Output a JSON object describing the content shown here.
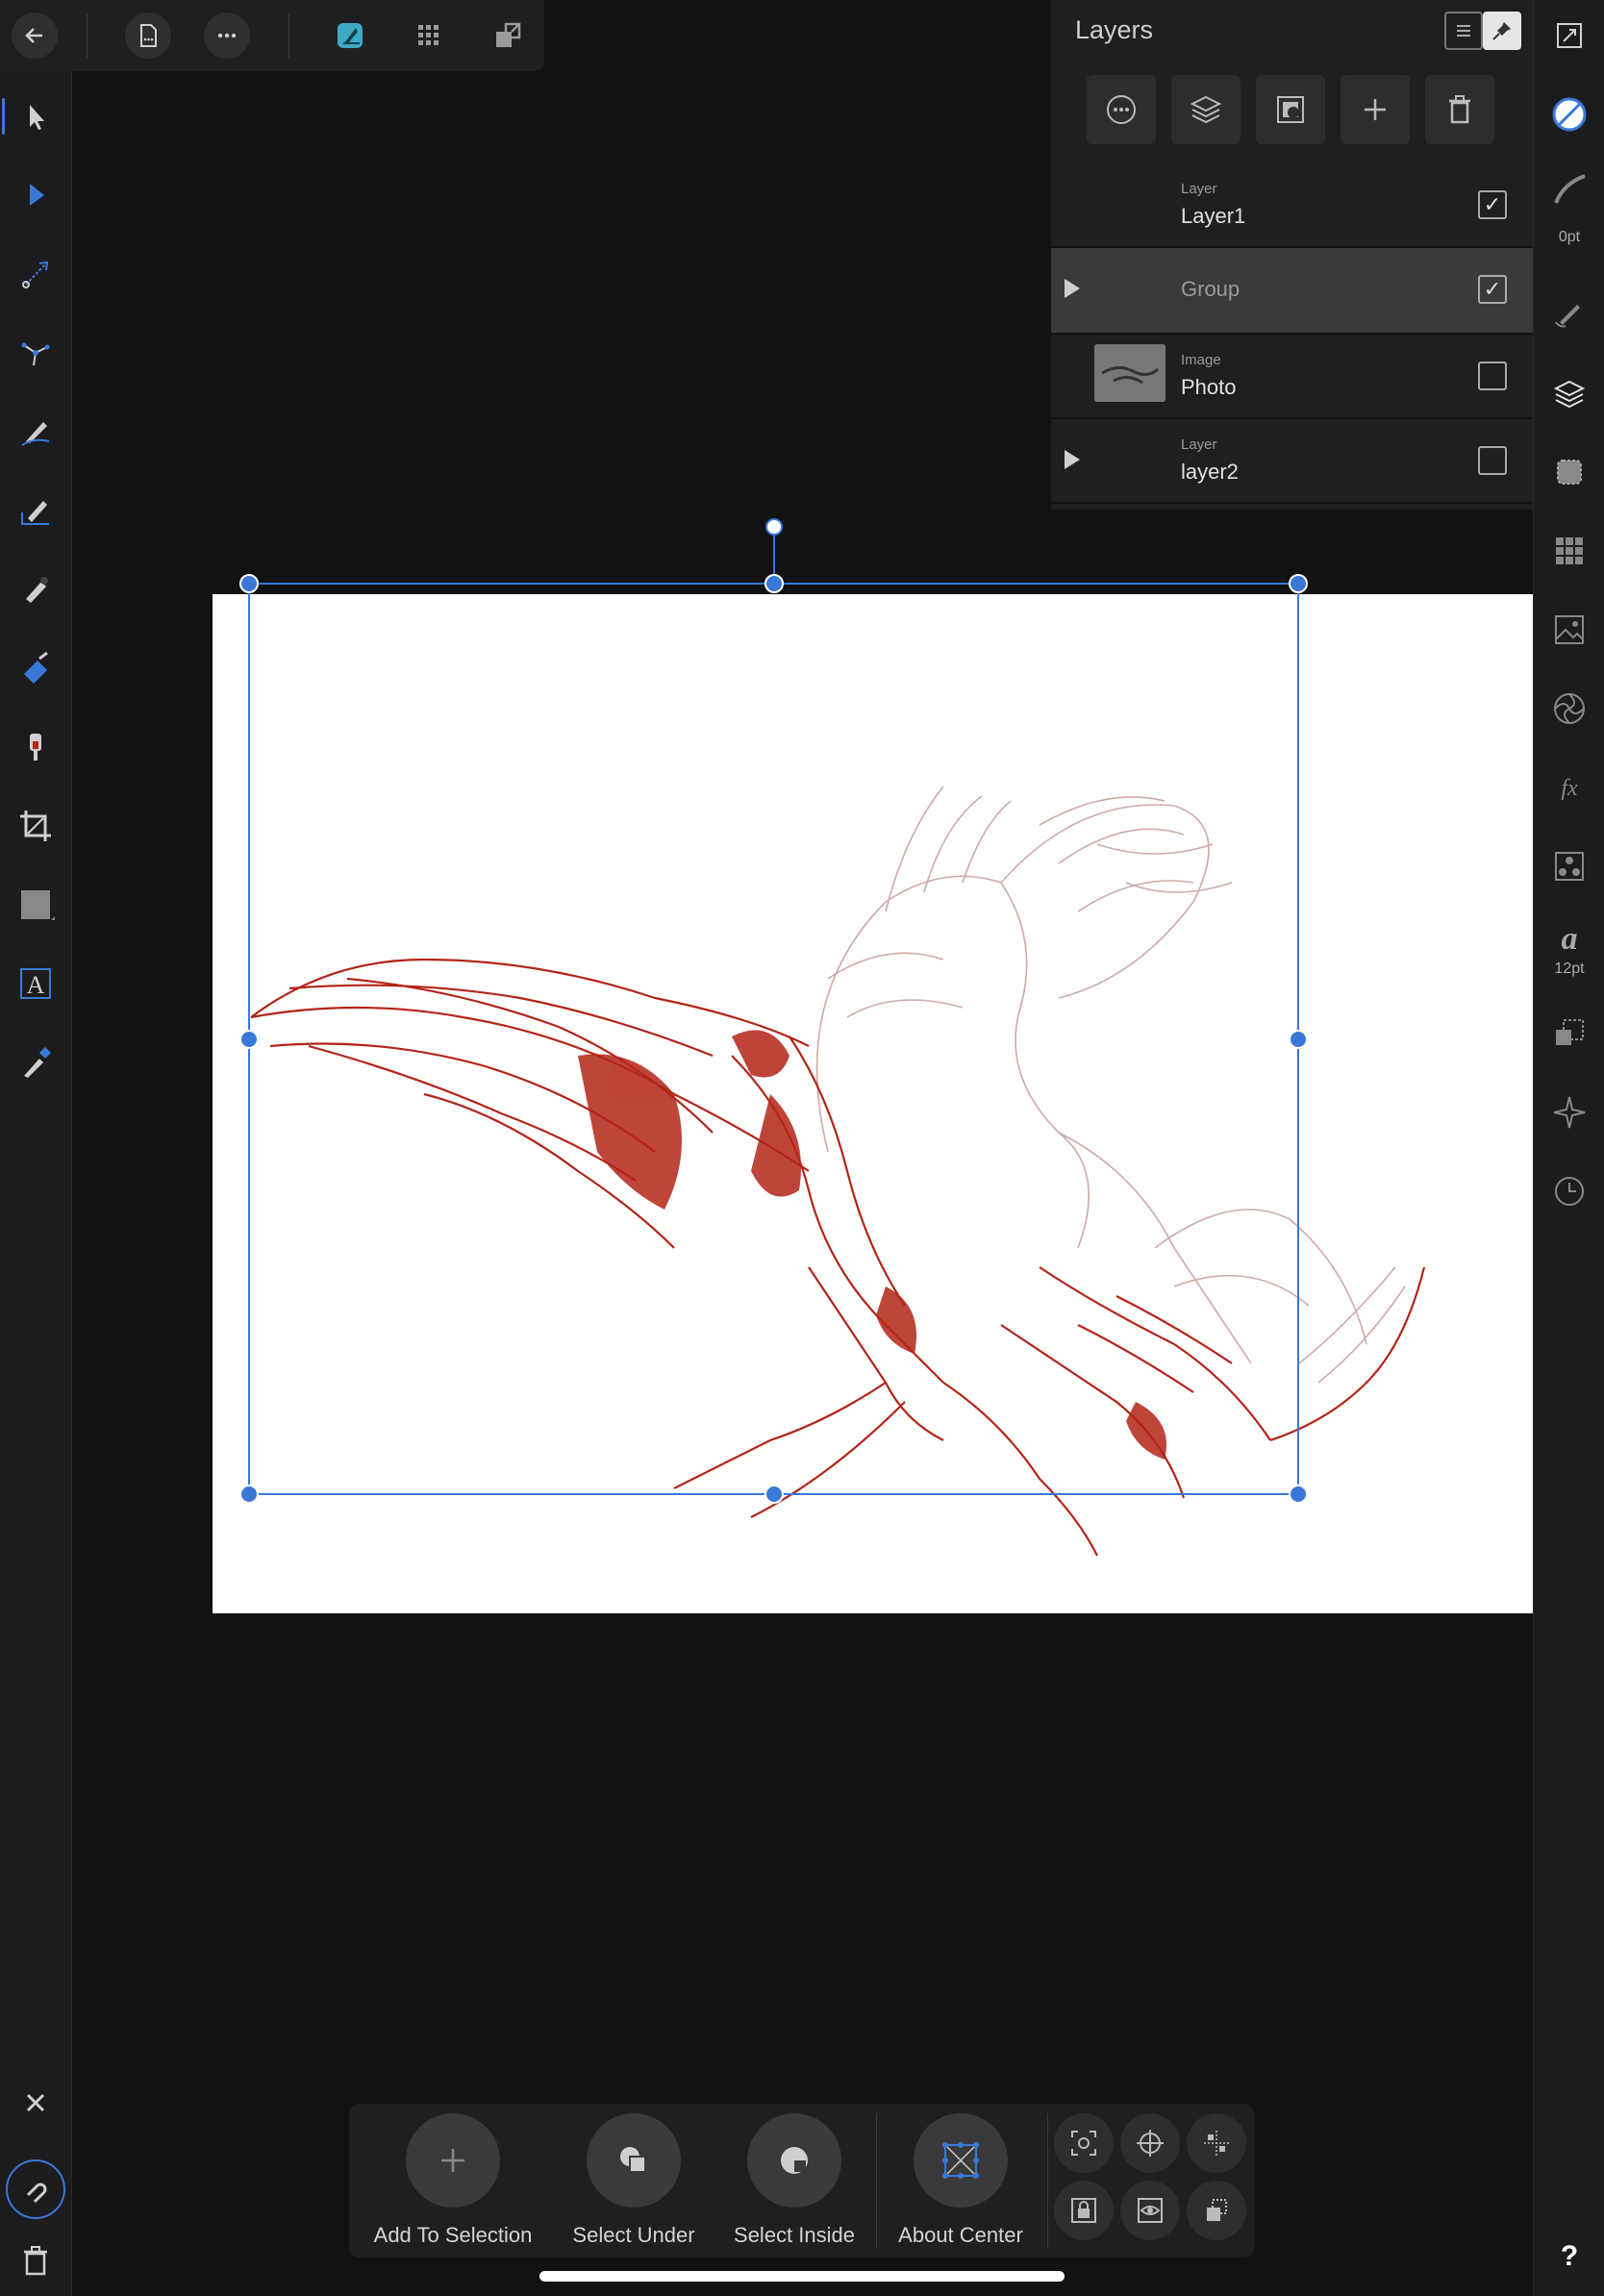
{
  "top_bar": {
    "icons": [
      "back-arrow-icon",
      "document-icon",
      "more-icon",
      "persona-designer-icon",
      "pixel-persona-icon",
      "export-persona-icon"
    ]
  },
  "left_toolbar": {
    "tools": [
      "move-tool-icon",
      "node-tool-icon",
      "point-transform-tool-icon",
      "corner-tool-icon",
      "pen-tool-icon",
      "pencil-tool-icon",
      "vector-brush-tool-icon",
      "fill-tool-icon",
      "transparency-tool-icon",
      "crop-tool-icon",
      "rectangle-tool-icon",
      "artistic-text-tool-icon",
      "color-picker-tool-icon"
    ],
    "bottom": [
      "close-icon",
      "undo-icon",
      "trash-icon"
    ]
  },
  "layers_panel": {
    "title": "Layers",
    "layers": [
      {
        "type": "Layer",
        "name": "Layer1",
        "checked": true,
        "expandable": false
      },
      {
        "type": "",
        "name": "Group",
        "checked": true,
        "expandable": true
      },
      {
        "type": "Image",
        "name": "Photo",
        "checked": false,
        "expandable": false
      },
      {
        "type": "Layer",
        "name": "layer2",
        "checked": false,
        "expandable": true
      }
    ]
  },
  "right_toolbar": {
    "stroke_width": "0pt",
    "text_size": "12pt",
    "help_label": "?"
  },
  "context_bar": {
    "add_to_selection": "Add To Selection",
    "select_under": "Select Under",
    "select_inside": "Select Inside",
    "about_center": "About Center"
  },
  "colors": {
    "accent": "#3a78d8",
    "drawing": "#b32418",
    "drawing_faded": "#c9a0a0"
  }
}
